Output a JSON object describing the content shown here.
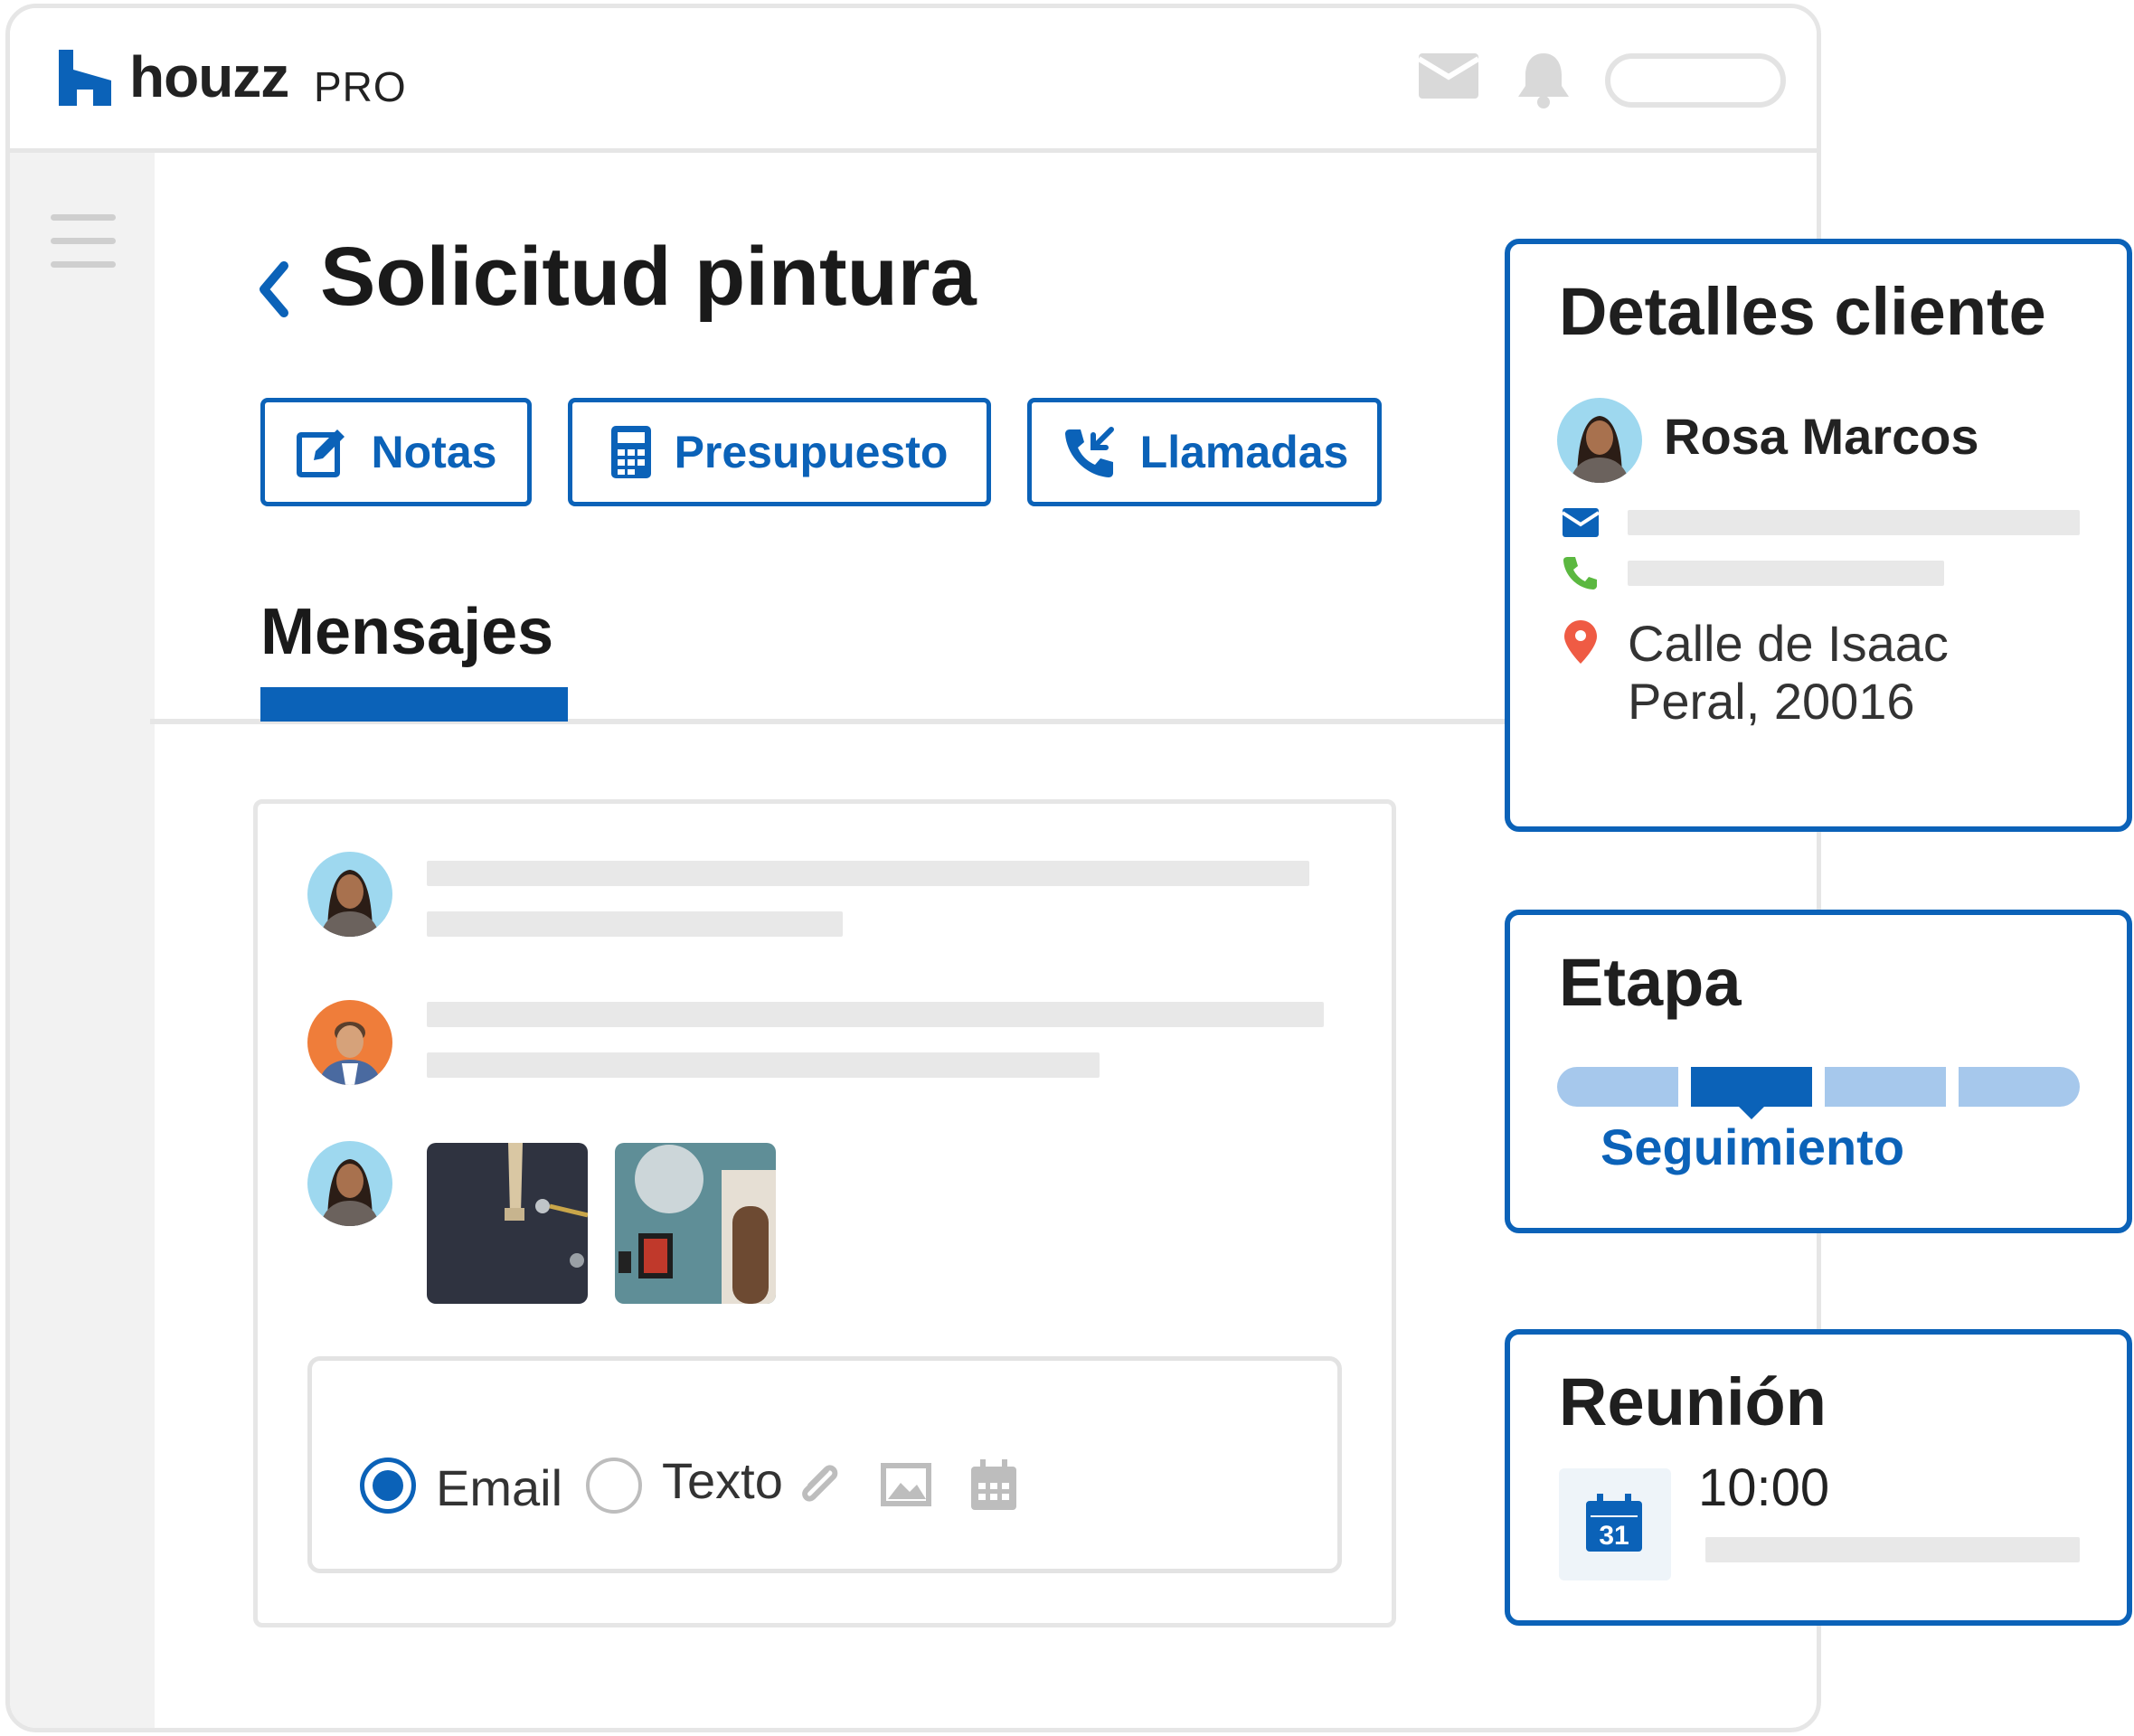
{
  "app": {
    "brand": "houzz",
    "brand_suffix": "PRO"
  },
  "colors": {
    "primary": "#0b62b8",
    "stage_light": "#a6c8ec",
    "phone": "#5bb840",
    "location": "#ef5b44",
    "skeleton": "#e8e8e8"
  },
  "page": {
    "title": "Solicitud pintura"
  },
  "actions": [
    {
      "label": "Notas",
      "icon": "edit-icon"
    },
    {
      "label": "Presupuesto",
      "icon": "calculator-icon"
    },
    {
      "label": "Llamadas",
      "icon": "incoming-call-icon"
    }
  ],
  "tabs": {
    "active": "Mensajes"
  },
  "composer": {
    "options": [
      "Email",
      "Texto"
    ],
    "selected": "Email"
  },
  "client": {
    "title": "Detalles cliente",
    "name": "Rosa Marcos",
    "address_line1": "Calle de Isaac",
    "address_line2": "Peral, 20016"
  },
  "stage": {
    "title": "Etapa",
    "current": "Seguimiento",
    "current_index": 2,
    "total_steps": 4
  },
  "meeting": {
    "title": "Reunión",
    "time": "10:00",
    "calendar_day": "31"
  }
}
